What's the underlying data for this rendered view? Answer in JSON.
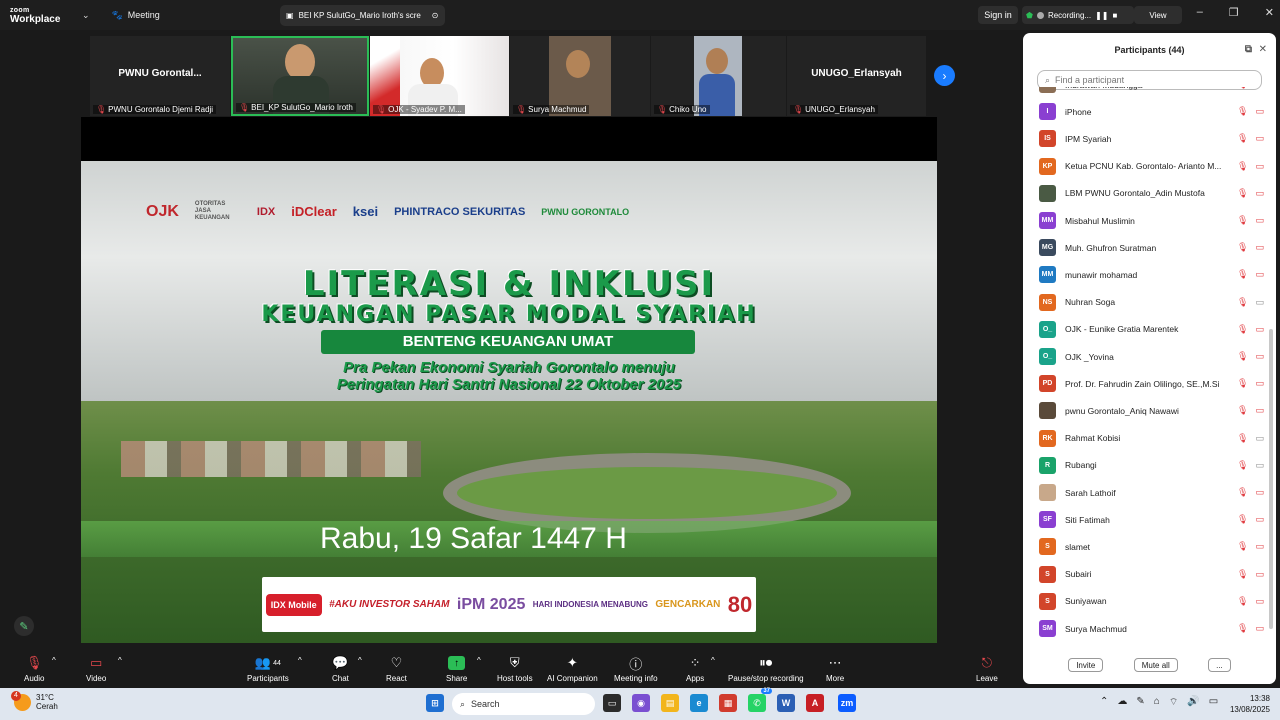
{
  "app": {
    "brand_top": "zoom",
    "brand_bottom": "Workplace",
    "meeting_label": "Meeting",
    "share_tab_title": "BEI KP SulutGo_Mario Iroth's scre",
    "signin_label": "Sign in",
    "recording_label": "Recording...",
    "view_label": "View"
  },
  "video_strip": [
    {
      "display_name": "PWNU  Gorontal...",
      "label": "PWNU Gorontalo Djemi Radji"
    },
    {
      "display_name": "",
      "label": "BEI_KP SulutGo_Mario Iroth"
    },
    {
      "display_name": "",
      "label": "OJK - Syadev P. M..."
    },
    {
      "display_name": "",
      "label": "Surya Machmud"
    },
    {
      "display_name": "",
      "label": "Chiko Uno"
    },
    {
      "display_name": "UNUGO_Erlansyah",
      "label": "UNUGO_Erlansyah"
    }
  ],
  "slide": {
    "logos": {
      "ojk": "OJK",
      "ojk_sub": "OTORITAS JASA KEUANGAN",
      "idx": "IDX",
      "idclear": "iDClear",
      "ksei": "ksei",
      "phintraco": "PHINTRACO SEKURITAS",
      "pwnu": "PWNU GORONTALO"
    },
    "title1": "LITERASI & INKLUSI",
    "title2": "KEUANGAN PASAR MODAL SYARIAH",
    "subtitle": "BENTENG KEUANGAN UMAT",
    "line1": "Pra Pekan Ekonomi Syariah Gorontalo menuju",
    "line2": "Peringatan Hari Santri Nasional 22 Oktober 2025",
    "date": "Rabu, 19 Safar 1447 H",
    "partners": {
      "idx_mobile": "IDX Mobile",
      "aku": "#AKU INVESTOR SAHAM",
      "ipm": "iPM 2025",
      "hari": "HARI INDONESIA MENABUNG",
      "gencarkan": "GENCARKAN",
      "eighty": "80"
    }
  },
  "participants_panel": {
    "title": "Participants (44)",
    "search_placeholder": "Find a participant",
    "items": [
      {
        "initials": "",
        "name": "Indrawan Mudangga",
        "color": "#8b6e55",
        "cam_on": false
      },
      {
        "initials": "I",
        "name": "iPhone",
        "color": "#8a3fd1",
        "cam_on": false
      },
      {
        "initials": "IS",
        "name": "IPM Syariah",
        "color": "#d2452a",
        "cam_on": false
      },
      {
        "initials": "KP",
        "name": "Ketua PCNU Kab. Gorontalo- Arianto M...",
        "color": "#e2681f",
        "cam_on": false
      },
      {
        "initials": "",
        "name": "LBM PWNU Gorontalo_Adin Mustofa",
        "color": "#4a5a44",
        "cam_on": false
      },
      {
        "initials": "MM",
        "name": "Misbahul Muslimin",
        "color": "#8a3fd1",
        "cam_on": false
      },
      {
        "initials": "MG",
        "name": "Muh. Ghufron Suratman",
        "color": "#3a4a5e",
        "cam_on": false
      },
      {
        "initials": "MM",
        "name": "munawir mohamad",
        "color": "#1f7ac2",
        "cam_on": false
      },
      {
        "initials": "NS",
        "name": "Nuhran Soga",
        "color": "#e2681f",
        "cam_on": true
      },
      {
        "initials": "O_",
        "name": "OJK - Eunike Gratia Marentek",
        "color": "#1aa38a",
        "cam_on": false
      },
      {
        "initials": "O_",
        "name": "OJK _Yovina",
        "color": "#1aa38a",
        "cam_on": false
      },
      {
        "initials": "PD",
        "name": "Prof. Dr. Fahrudin Zain Olilingo, SE.,M.Si",
        "color": "#d2452a",
        "cam_on": false
      },
      {
        "initials": "",
        "name": "pwnu Gorontalo_Aniq Nawawi",
        "color": "#5a4a3a",
        "cam_on": false
      },
      {
        "initials": "RK",
        "name": "Rahmat Kobisi",
        "color": "#e2681f",
        "cam_on": true
      },
      {
        "initials": "R",
        "name": "Rubangi",
        "color": "#1aa36a",
        "cam_on": true
      },
      {
        "initials": "",
        "name": "Sarah Lathoif",
        "color": "#c8a88a",
        "cam_on": false
      },
      {
        "initials": "SF",
        "name": "Siti Fatimah",
        "color": "#8a3fd1",
        "cam_on": false
      },
      {
        "initials": "S",
        "name": "slamet",
        "color": "#e2681f",
        "cam_on": false
      },
      {
        "initials": "S",
        "name": "Subairi",
        "color": "#d2452a",
        "cam_on": false
      },
      {
        "initials": "S",
        "name": "Suniyawan",
        "color": "#d2452a",
        "cam_on": false
      },
      {
        "initials": "SM",
        "name": "Surya Machmud",
        "color": "#8a3fd1",
        "cam_on": false
      }
    ],
    "invite_label": "Invite",
    "mute_all_label": "Mute all",
    "more_label": "..."
  },
  "toolbar": {
    "audio": "Audio",
    "video": "Video",
    "participants": "Participants",
    "participants_count": "44",
    "chat": "Chat",
    "react": "React",
    "share": "Share",
    "host_tools": "Host tools",
    "ai_companion": "AI Companion",
    "meeting_info": "Meeting info",
    "apps": "Apps",
    "pause_stop_recording": "Pause/stop recording",
    "more": "More",
    "leave": "Leave"
  },
  "taskbar": {
    "weather_badge": "4",
    "temperature": "31°C",
    "condition": "Cerah",
    "search_label": "Search",
    "whatsapp_badge": "37",
    "time": "13:38",
    "date": "13/08/2025"
  },
  "colors": {
    "accent": "#1a7cff",
    "share_green": "#2bbd56",
    "mute_red": "#e5484d"
  }
}
